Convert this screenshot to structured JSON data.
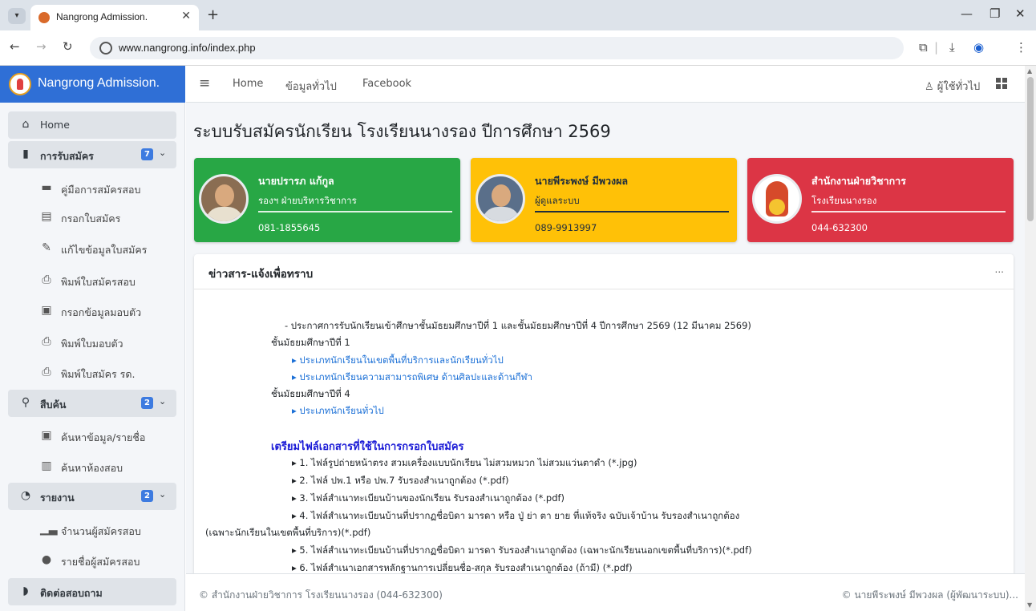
{
  "browser": {
    "tab_title": "Nangrong Admission.",
    "url": "www.nangrong.info/index.php"
  },
  "sidebar": {
    "brand": "Nangrong Admission.",
    "items": [
      {
        "label": "Home",
        "icon": "home-icon"
      },
      {
        "label": "การรับสมัคร",
        "icon": "file-icon",
        "badge": "7"
      },
      {
        "label": "คู่มือการสมัครสอบ",
        "icon": "book-icon"
      },
      {
        "label": "กรอกใบสมัคร",
        "icon": "form-icon"
      },
      {
        "label": "แก้ไขข้อมูลใบสมัคร",
        "icon": "edit-icon"
      },
      {
        "label": "พิมพ์ใบสมัครสอบ",
        "icon": "print-icon"
      },
      {
        "label": "กรอกข้อมูลมอบตัว",
        "icon": "id-card-icon"
      },
      {
        "label": "พิมพ์ใบมอบตัว",
        "icon": "print-icon"
      },
      {
        "label": "พิมพ์ใบสมัคร รด.",
        "icon": "print-icon"
      },
      {
        "label": "สืบค้น",
        "icon": "search-icon",
        "badge": "2"
      },
      {
        "label": "ค้นหาข้อมูล/รายชื่อ",
        "icon": "contact-icon"
      },
      {
        "label": "ค้นหาห้องสอบ",
        "icon": "building-icon"
      },
      {
        "label": "รายงาน",
        "icon": "pie-chart-icon",
        "badge": "2"
      },
      {
        "label": "จำนวนผู้สมัครสอบ",
        "icon": "bar-chart-icon"
      },
      {
        "label": "รายชื่อผู้สมัครสอบ",
        "icon": "users-icon"
      },
      {
        "label": "ติดต่อสอบถาม",
        "icon": "chat-icon"
      }
    ]
  },
  "topnav": {
    "links": [
      "Home",
      "ข้อมูลทั่วไป",
      "Facebook"
    ],
    "user": "ผู้ใช้ทั่วไป"
  },
  "page": {
    "title": "ระบบรับสมัครนักเรียน โรงเรียนนางรอง ปีการศึกษา 2569"
  },
  "info_boxes": [
    {
      "name": "นายปรารภ แก้กูล",
      "role": "รองฯ ฝ่ายบริหารวิชาการ",
      "phone": "081-1855645"
    },
    {
      "name": "นายพีระพงษ์ มีพวงผล",
      "role": "ผู้ดูแลระบบ",
      "phone": "089-9913997"
    },
    {
      "name": "สำนักงานฝ่ายวิชาการ",
      "role": "โรงเรียนนางรอง",
      "phone": "044-632300"
    }
  ],
  "news": {
    "title": "ข่าวสาร-แจ้งเพื่อทราบ",
    "tools": "...",
    "announcement": "- ประกาศการรับนักเรียนเข้าศึกษาชั้นมัธยมศึกษาปีที่ 1 และชั้นมัธยมศึกษาปีที่ 4 ปีการศึกษา 2569 (12 มีนาคม 2569)",
    "m1_heading": "ชั้นมัธยมศึกษาปีที่ 1",
    "m1_link1": "▸ ประเภทนักเรียนในเขตพื้นที่บริการและนักเรียนทั่วไป",
    "m1_link2": "▸ ประเภทนักเรียนความสามารถพิเศษ ด้านศิลปะและด้านกีฬา",
    "m4_heading": "ชั้นมัธยมศึกษาปีที่ 4",
    "m4_link1": "▸ ประเภทนักเรียนทั่วไป",
    "docs_heading": "เตรียมไฟล์เอกสารที่ใช้ในการกรอกใบสมัคร",
    "doc1": "▸ 1. ไฟล์รูปถ่ายหน้าตรง สวมเครื่องแบบนักเรียน ไม่สวมหมวก ไม่สวมแว่นตาดำ (*.jpg)",
    "doc2": "▸ 2. ไฟล์ ปพ.1 หรือ ปพ.7 รับรองสำเนาถูกต้อง (*.pdf)",
    "doc3": "▸ 3. ไฟล์สำเนาทะเบียนบ้านของนักเรียน รับรองสำเนาถูกต้อง (*.pdf)",
    "doc4": "▸ 4. ไฟล์สำเนาทะเบียนบ้านที่ปรากฏชื่อบิดา มารดา หรือ ปู่ ย่า ตา ยาย ที่แท้จริง ฉบับเจ้าบ้าน รับรองสำเนาถูกต้อง",
    "doc4_cont": "(เฉพาะนักเรียนในเขตพื้นที่บริการ)(*.pdf)",
    "doc5": "▸ 5. ไฟล์สำเนาทะเบียนบ้านที่ปรากฏชื่อบิดา มารดา รับรองสำเนาถูกต้อง (เฉพาะนักเรียนนอกเขตพื้นที่บริการ)(*.pdf)",
    "doc6": "▸ 6. ไฟล์สำเนาเอกสารหลักฐานการเปลี่ยนชื่อ-สกุล รับรองสำเนาถูกต้อง (ถ้ามี) (*.pdf)"
  },
  "footer": {
    "left": "© สำนักงานฝ่ายวิชาการ โรงเรียนนางรอง (044-632300)",
    "right": "© นายพีระพงษ์ มีพวงผล (ผู้พัฒนาระบบ)..."
  }
}
